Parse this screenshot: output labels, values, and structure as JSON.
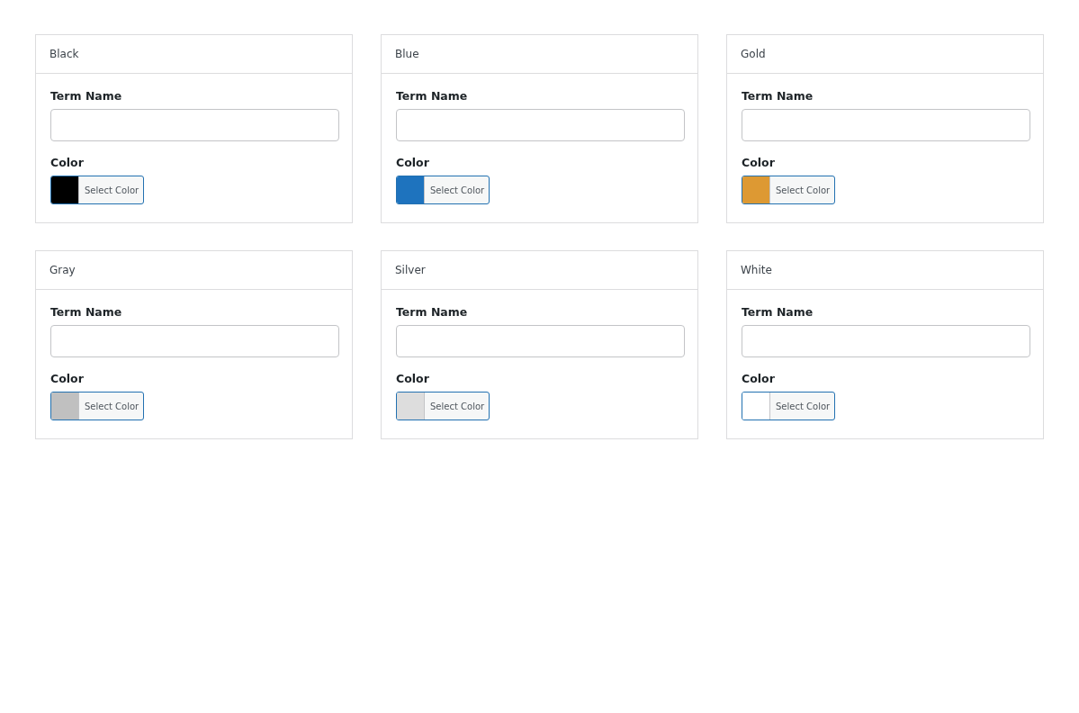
{
  "cards": [
    {
      "title": "Black",
      "name_label": "Term Name",
      "color_label": "Color",
      "button_label": "Select Color",
      "color": "#000000"
    },
    {
      "title": "Blue",
      "name_label": "Term Name",
      "color_label": "Color",
      "button_label": "Select Color",
      "color": "#1e73be"
    },
    {
      "title": "Gold",
      "name_label": "Term Name",
      "color_label": "Color",
      "button_label": "Select Color",
      "color": "#dd9933"
    },
    {
      "title": "Gray",
      "name_label": "Term Name",
      "color_label": "Color",
      "button_label": "Select Color",
      "color": "#c0c0c0"
    },
    {
      "title": "Silver",
      "name_label": "Term Name",
      "color_label": "Color",
      "button_label": "Select Color",
      "color": "#dddddd"
    },
    {
      "title": "White",
      "name_label": "Term Name",
      "color_label": "Color",
      "button_label": "Select Color",
      "color": "#ffffff"
    }
  ]
}
